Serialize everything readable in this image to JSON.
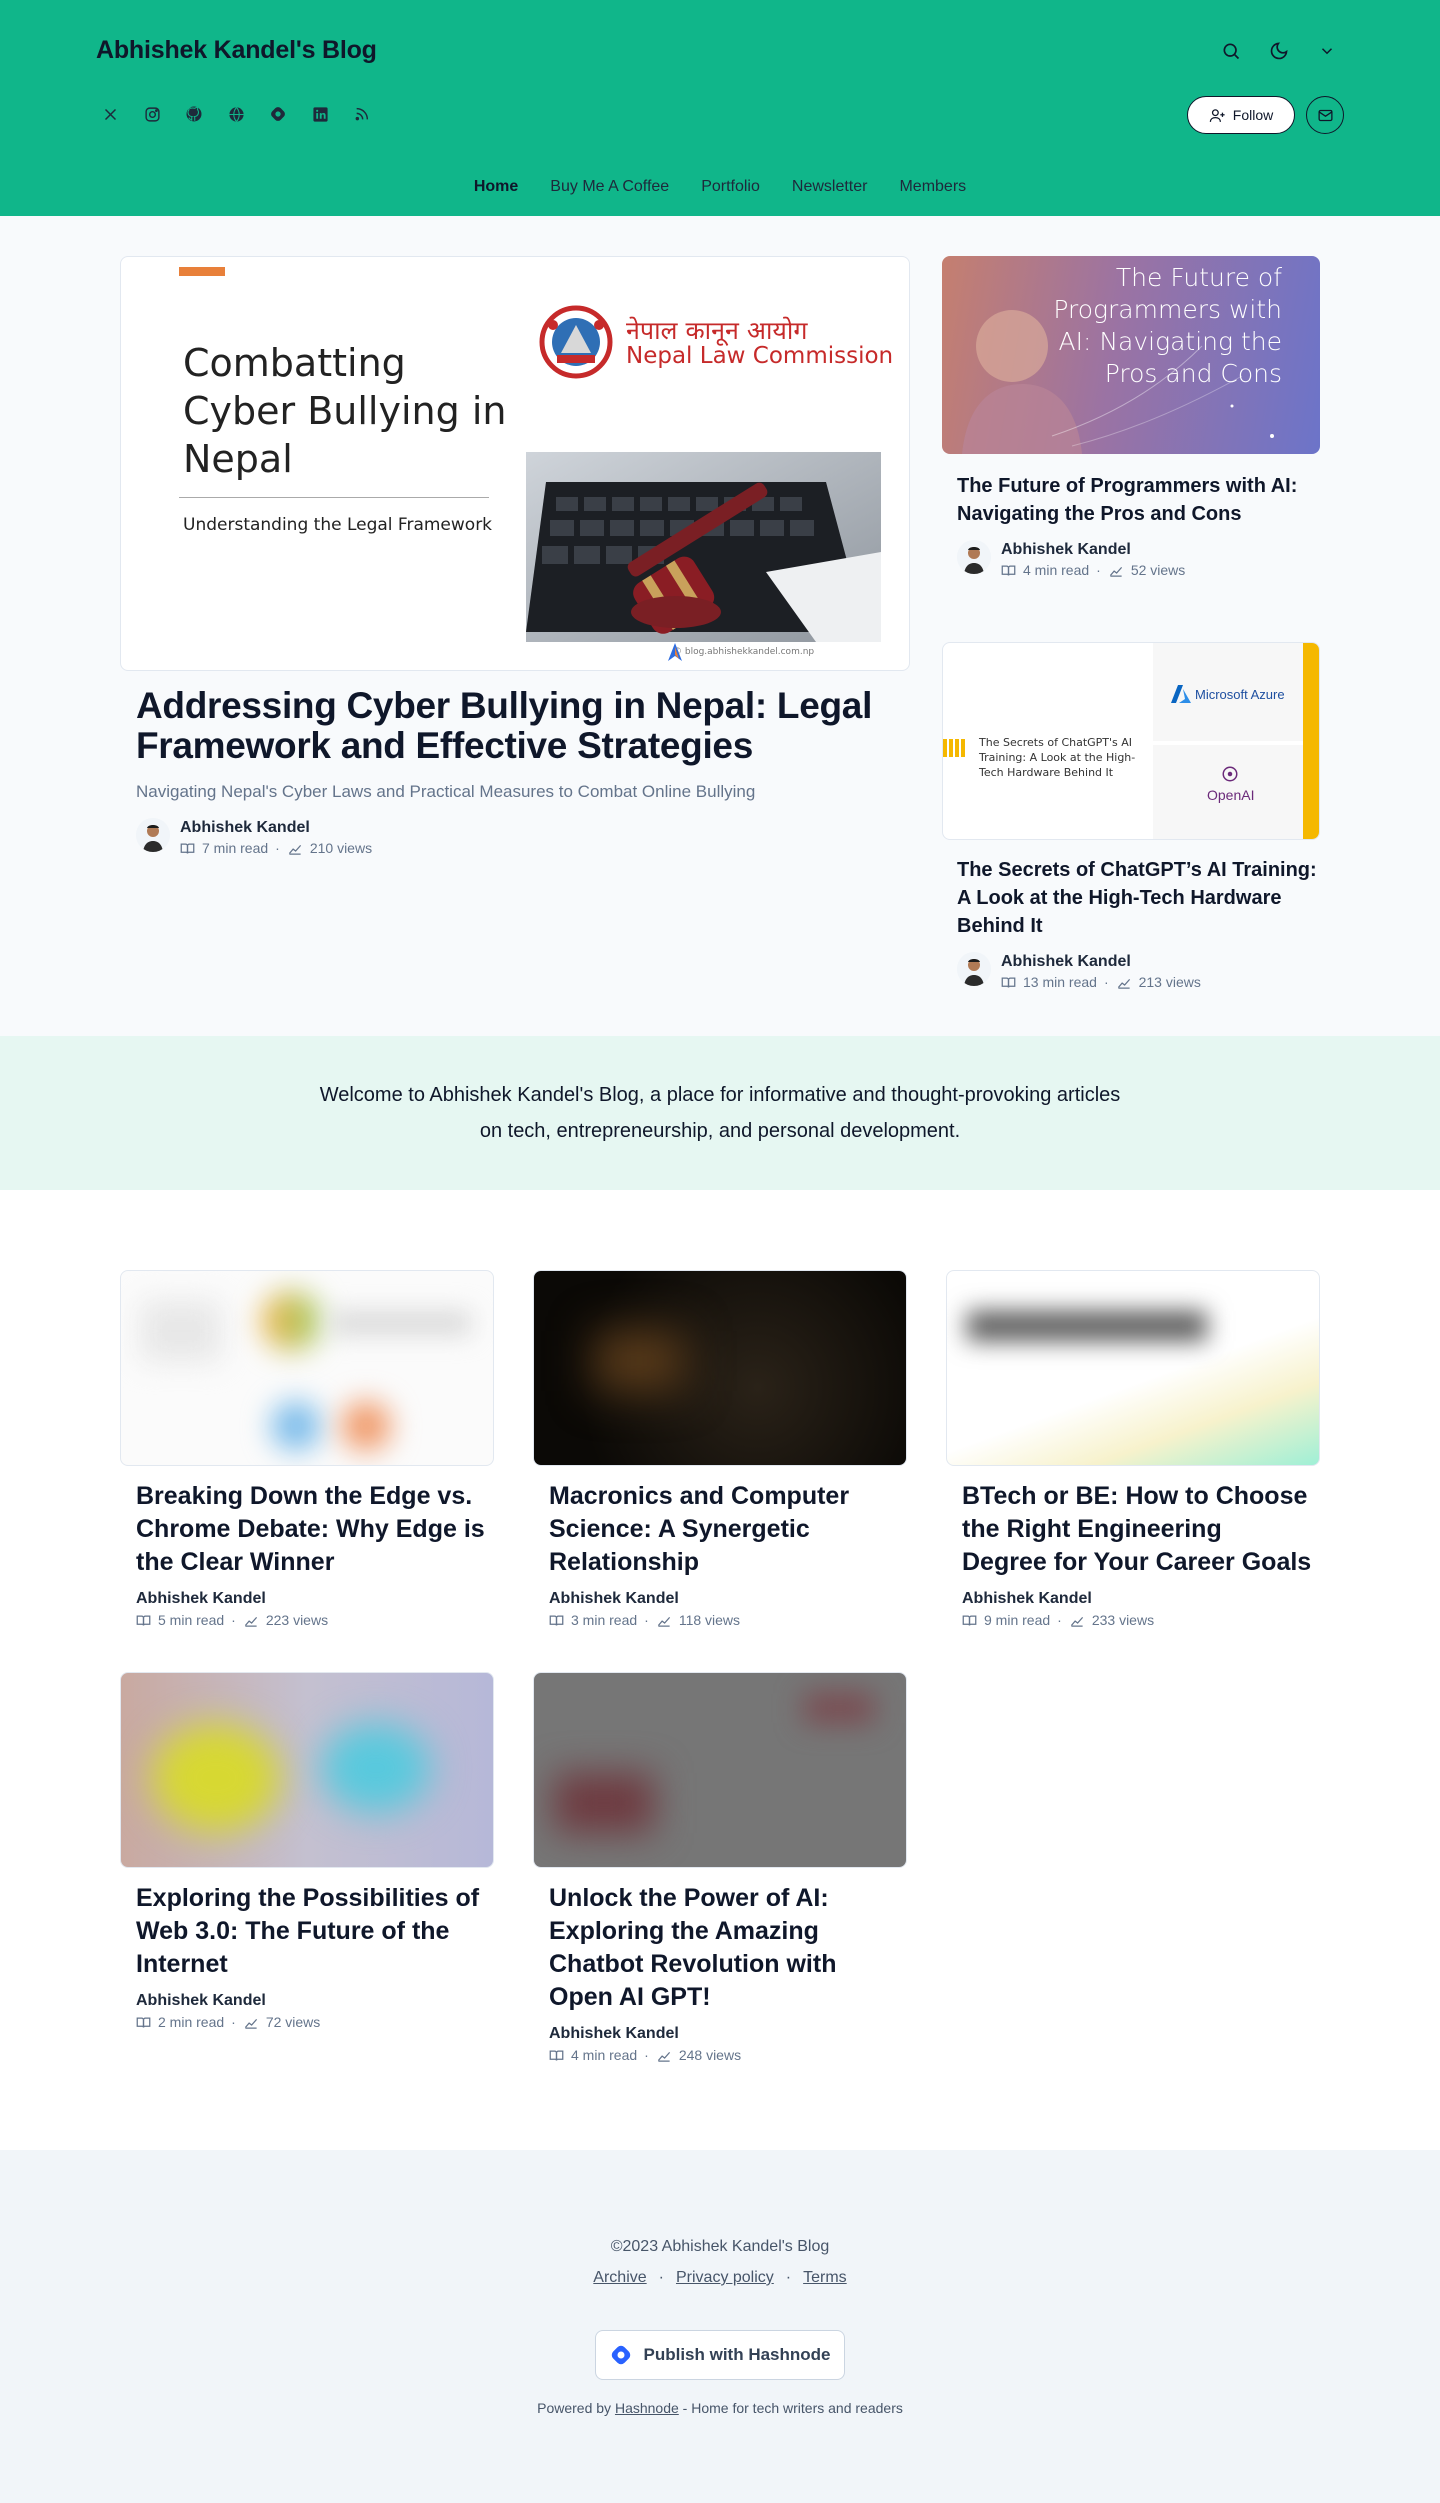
{
  "header": {
    "blog_title": "Abhishek Kandel's Blog",
    "follow_label": "Follow",
    "nav": [
      {
        "label": "Home",
        "active": true
      },
      {
        "label": "Buy Me A Coffee"
      },
      {
        "label": "Portfolio"
      },
      {
        "label": "Newsletter"
      },
      {
        "label": "Members"
      }
    ],
    "social_icons": [
      "x-icon",
      "instagram-icon",
      "github-icon",
      "globe-icon",
      "hashnode-icon",
      "linkedin-icon",
      "rss-icon"
    ],
    "accent_color": "#10b68a"
  },
  "featured": {
    "image_text": {
      "title_line1": "Combatting",
      "title_line2": "Cyber Bullying in",
      "title_line3": "Nepal",
      "subtitle": "Understanding the Legal Framework",
      "org_nepali": "नेपाल कानून आयोग",
      "org_english": "Nepal Law Commission",
      "url": "© blog.abhishekkandel.com.np"
    },
    "title": "Addressing Cyber Bullying in Nepal: Legal Framework and Effective Strategies",
    "subtitle": "Navigating Nepal's Cyber Laws and Practical Measures to Combat Online Bullying",
    "author": "Abhishek Kandel",
    "read_time": "7 min read",
    "views": "210 views"
  },
  "side_posts": [
    {
      "image_text": "The Future of Programmers with AI: Navigating the Pros and Cons",
      "title": "The Future of Programmers with AI: Navigating the Pros and Cons",
      "author": "Abhishek Kandel",
      "read_time": "4 min read",
      "views": "52 views"
    },
    {
      "image_text": "The Secrets of ChatGPT's AI Training: A Look at the High-Tech Hardware Behind It",
      "image_logo1": "Microsoft Azure",
      "image_logo2": "OpenAI",
      "title": "The Secrets of ChatGPT’s AI Training: A Look at the High-Tech Hardware Behind It",
      "author": "Abhishek Kandel",
      "read_time": "13 min read",
      "views": "213 views"
    }
  ],
  "welcome": {
    "text": "Welcome to Abhishek Kandel's Blog, a place for informative and thought-provoking articles on tech, entrepreneurship, and personal development."
  },
  "posts": [
    {
      "title": "Breaking Down the Edge vs. Chrome Debate: Why Edge is the Clear Winner",
      "author": "Abhishek Kandel",
      "read_time": "5 min read",
      "views": "223 views"
    },
    {
      "title": "Macronics and Computer Science: A Synergetic Relationship",
      "author": "Abhishek Kandel",
      "read_time": "3 min read",
      "views": "118 views"
    },
    {
      "title": "BTech or BE: How to Choose the Right Engineering Degree for Your Career Goals",
      "author": "Abhishek Kandel",
      "read_time": "9 min read",
      "views": "233 views"
    },
    {
      "title": "Exploring the Possibilities of Web 3.0: The Future of the Internet",
      "author": "Abhishek Kandel",
      "read_time": "2 min read",
      "views": "72 views"
    },
    {
      "title": "Unlock the Power of AI: Exploring the Amazing Chatbot Revolution with Open AI GPT!",
      "author": "Abhishek Kandel",
      "read_time": "4 min read",
      "views": "248 views"
    }
  ],
  "footer": {
    "copyright": "©2023 Abhishek Kandel's Blog",
    "links": [
      "Archive",
      "Privacy policy",
      "Terms"
    ],
    "separator": "·",
    "meta_separator": "·",
    "publish_label": "Publish with Hashnode",
    "powered_prefix": "Powered by",
    "powered_link": "Hashnode",
    "powered_suffix": "- Home for tech writers and readers"
  }
}
